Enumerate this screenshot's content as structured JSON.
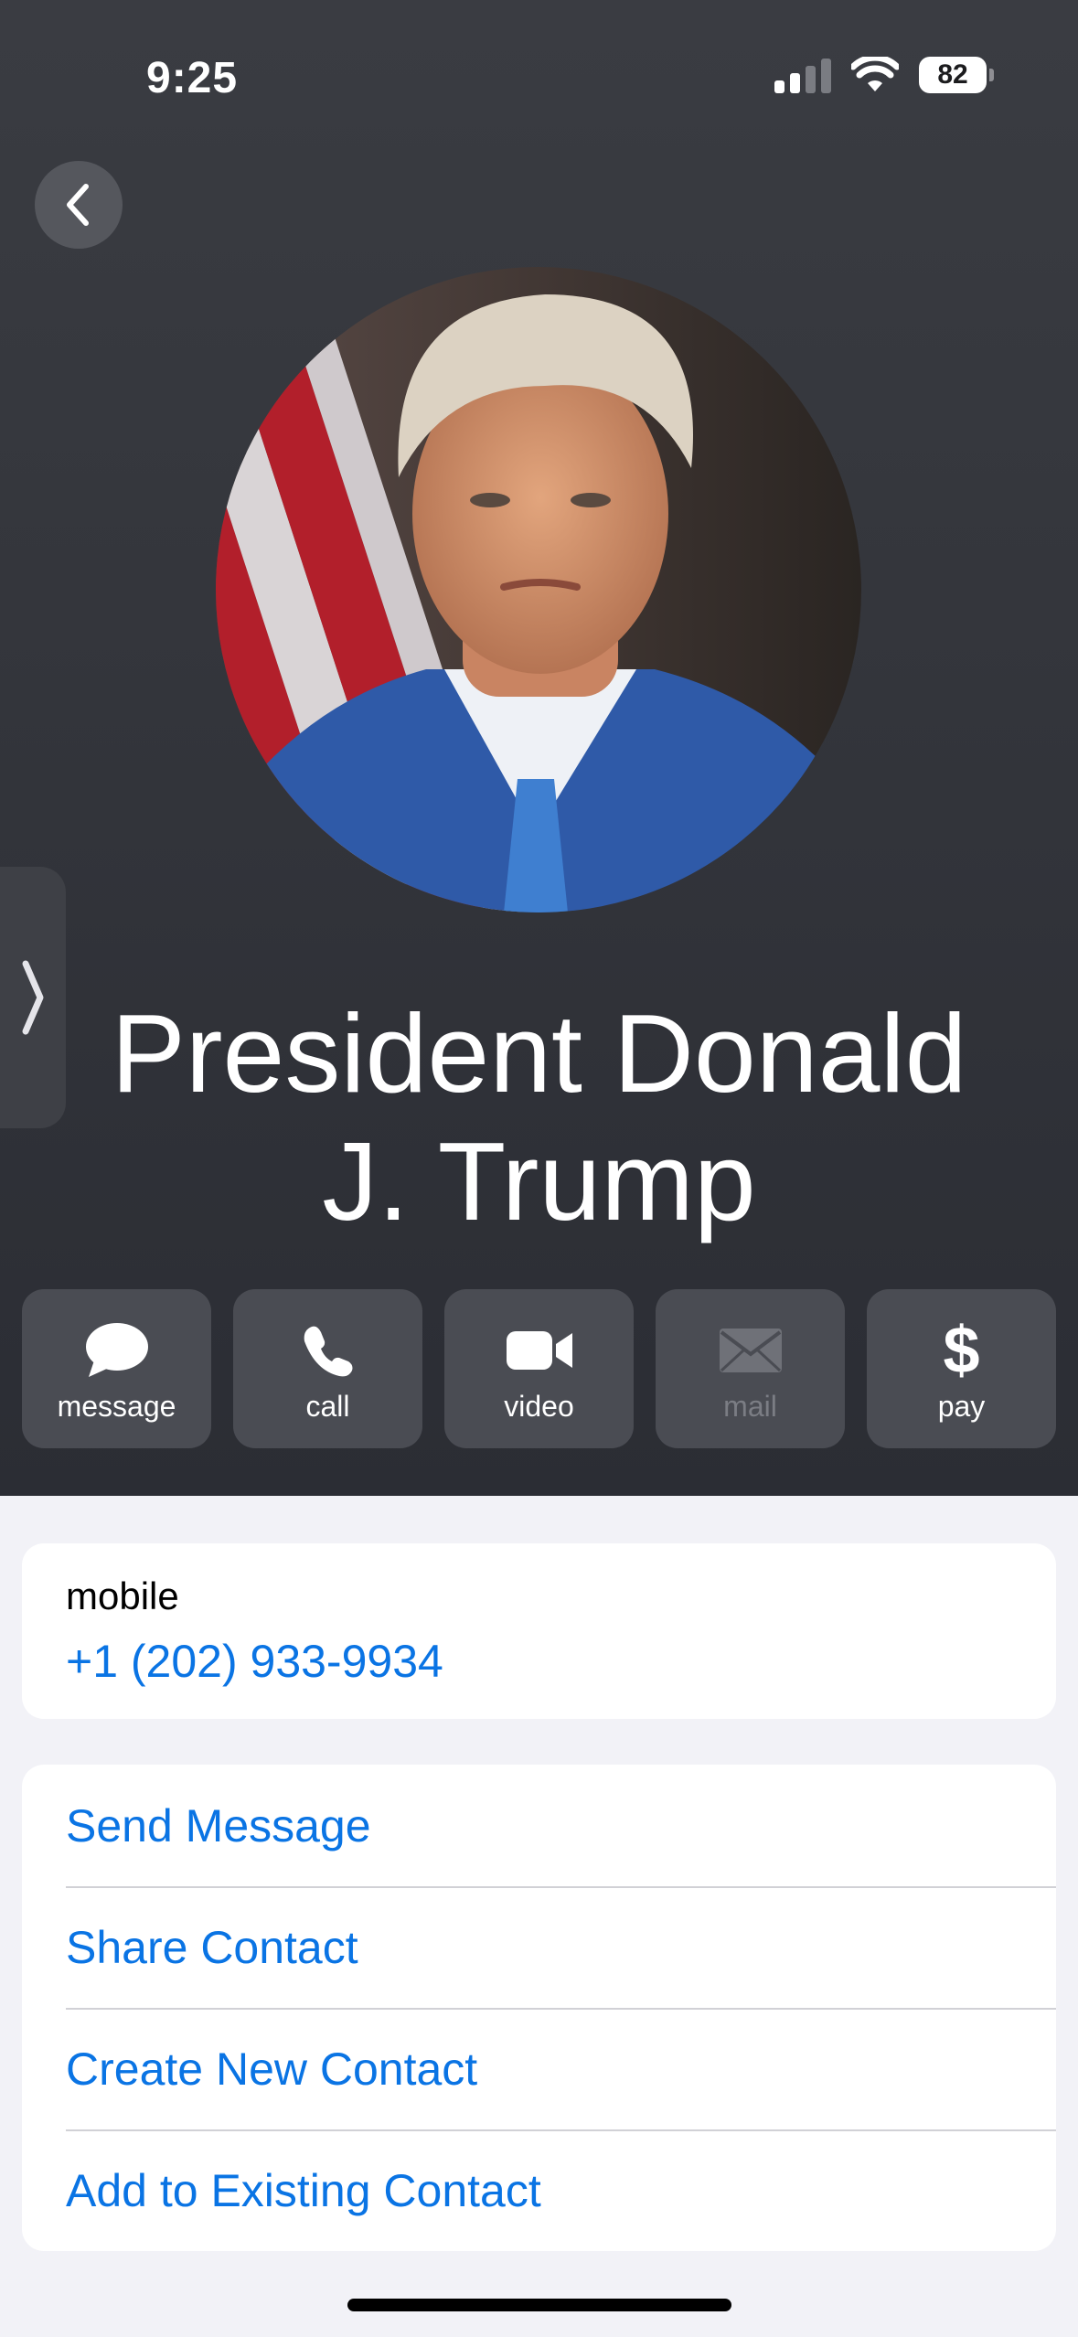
{
  "status_bar": {
    "time": "9:25",
    "battery": "82",
    "icons": [
      "cellular-signal-icon",
      "wifi-icon",
      "battery-icon"
    ]
  },
  "header": {
    "back_icon": "chevron-left-icon",
    "side_icon": "chevron-right-icon",
    "contact_name": "President Donald J. Trump"
  },
  "actions": [
    {
      "label": "message",
      "icon": "speech-bubble-icon",
      "enabled": true
    },
    {
      "label": "call",
      "icon": "phone-icon",
      "enabled": true
    },
    {
      "label": "video",
      "icon": "video-camera-icon",
      "enabled": true
    },
    {
      "label": "mail",
      "icon": "envelope-icon",
      "enabled": false
    },
    {
      "label": "pay",
      "icon": "dollar-icon",
      "enabled": true
    }
  ],
  "phone": {
    "label": "mobile",
    "number": "+1 (202) 933-9934"
  },
  "menu": [
    {
      "label": "Send Message"
    },
    {
      "label": "Share Contact"
    },
    {
      "label": "Create New Contact"
    },
    {
      "label": "Add to Existing Contact"
    }
  ],
  "colors": {
    "header_bg": "#34363c",
    "action_bg": "#4a4c53",
    "link_blue": "#0a74e4",
    "page_bg": "#f2f2f7"
  }
}
